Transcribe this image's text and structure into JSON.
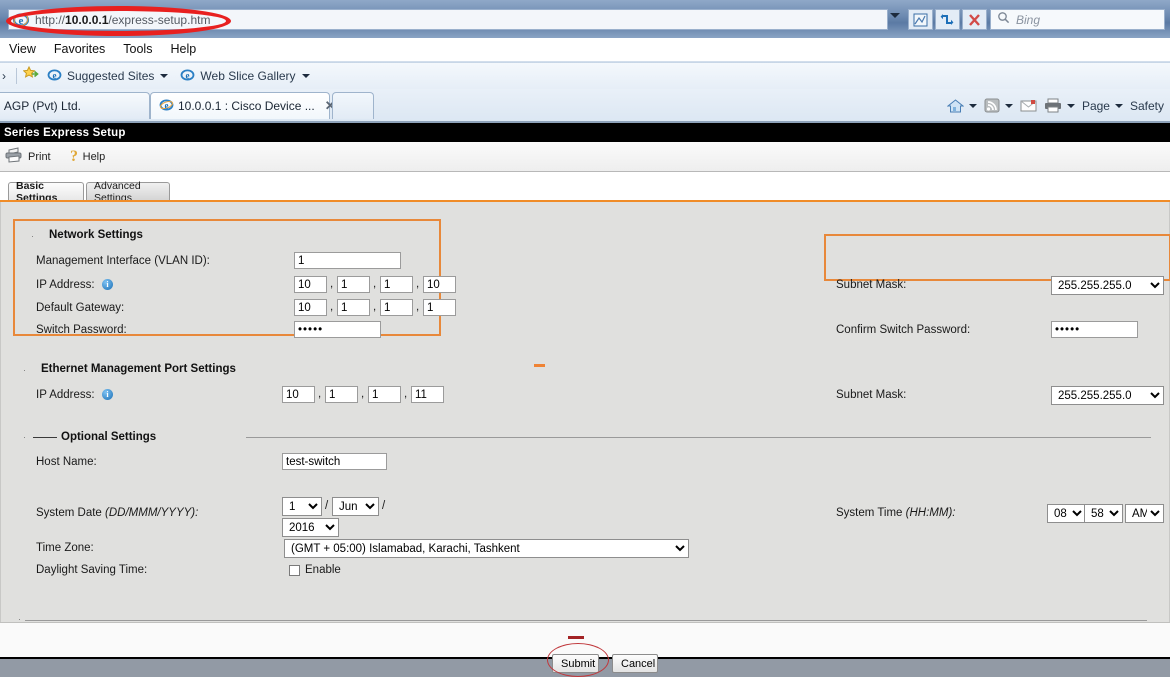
{
  "browser": {
    "url_prefix": "http://",
    "url_host": "10.0.0.1",
    "url_path": "/express-setup.htm",
    "url_full": "http://10.0.0.1/express-setup.htm",
    "search_placeholder": "Bing",
    "menu": [
      "View",
      "Favorites",
      "Tools",
      "Help"
    ],
    "favorites": [
      {
        "label": "Suggested Sites",
        "icon": "ie-icon",
        "caret": true
      },
      {
        "label": "Web Slice Gallery",
        "icon": "ie-icon",
        "caret": true
      }
    ],
    "tabs": [
      {
        "label": "AGP (Pvt) Ltd.",
        "active": false,
        "closable": false
      },
      {
        "label": "10.0.0.1 : Cisco Device ...",
        "active": true,
        "closable": true,
        "close_label": "✕"
      }
    ],
    "command_bar": [
      {
        "label": "",
        "icon": "home-icon",
        "caret": true
      },
      {
        "label": "",
        "icon": "feeds-icon",
        "caret": true
      },
      {
        "label": "",
        "icon": "mail-icon",
        "caret": false
      },
      {
        "label": "",
        "icon": "print-icon",
        "caret": true
      },
      {
        "label": "Page",
        "icon": "",
        "caret": true
      },
      {
        "label": "Safety",
        "icon": "",
        "caret": false
      }
    ],
    "toolbar_icons": [
      "compat-view-icon",
      "refresh-icon",
      "stop-icon"
    ]
  },
  "app": {
    "title": "Series Express Setup",
    "toolbar": [
      {
        "label": "Print",
        "icon": "printer-icon"
      },
      {
        "label": "Help",
        "icon": "question-icon"
      }
    ],
    "tabs": [
      {
        "label": "Basic Settings",
        "active": true
      },
      {
        "label": "Advanced Settings",
        "active": false
      }
    ]
  },
  "network_settings": {
    "heading": "Network Settings",
    "vlan_label": "Management Interface (VLAN ID):",
    "vlan_value": "1",
    "ip_label": "IP Address:",
    "ip_octets": [
      "10",
      "1",
      "1",
      "10"
    ],
    "gateway_label": "Default Gateway:",
    "gateway_octets": [
      "10",
      "1",
      "1",
      "1"
    ],
    "password_label": "Switch Password:",
    "password_value": "•••••",
    "subnet_label": "Subnet Mask:",
    "subnet_value": "255.255.255.0",
    "confirm_label": "Confirm Switch Password:",
    "confirm_value": "•••••",
    "separator": ","
  },
  "ethernet_settings": {
    "heading": "Ethernet Management Port Settings",
    "ip_label": "IP Address:",
    "ip_octets": [
      "10",
      "1",
      "1",
      "11"
    ],
    "subnet_label": "Subnet Mask:",
    "subnet_value": "255.255.255.0"
  },
  "optional_settings": {
    "heading": "Optional Settings",
    "host_label": "Host Name:",
    "host_value": "test-switch",
    "date_label": "System Date",
    "date_format": "(DD/MMM/YYYY):",
    "date_day": "1",
    "date_month": "Jun",
    "date_year": "2016",
    "date_sep": "/",
    "time_label": "System Time",
    "time_format": "(HH:MM):",
    "time_hour": "08",
    "time_minute": "58",
    "time_meridiem": "AM",
    "time_sep": ":",
    "timezone_label": "Time Zone:",
    "timezone_value": "(GMT + 05:00) Islamabad, Karachi, Tashkent",
    "dst_label": "Daylight Saving Time:",
    "dst_checkbox_label": "Enable",
    "dst_checked": false
  },
  "footer": {
    "submit_label": "Submit",
    "cancel_label": "Cancel"
  },
  "colors": {
    "accent_orange": "#f08c28",
    "highlight_box": "#e8883a",
    "annotation_red": "#e8201f",
    "annotation_ellipse": "#c0383c",
    "title_bar": "#000000",
    "form_bg": "#e0e0de",
    "bottom_bar": "#929aa5"
  }
}
